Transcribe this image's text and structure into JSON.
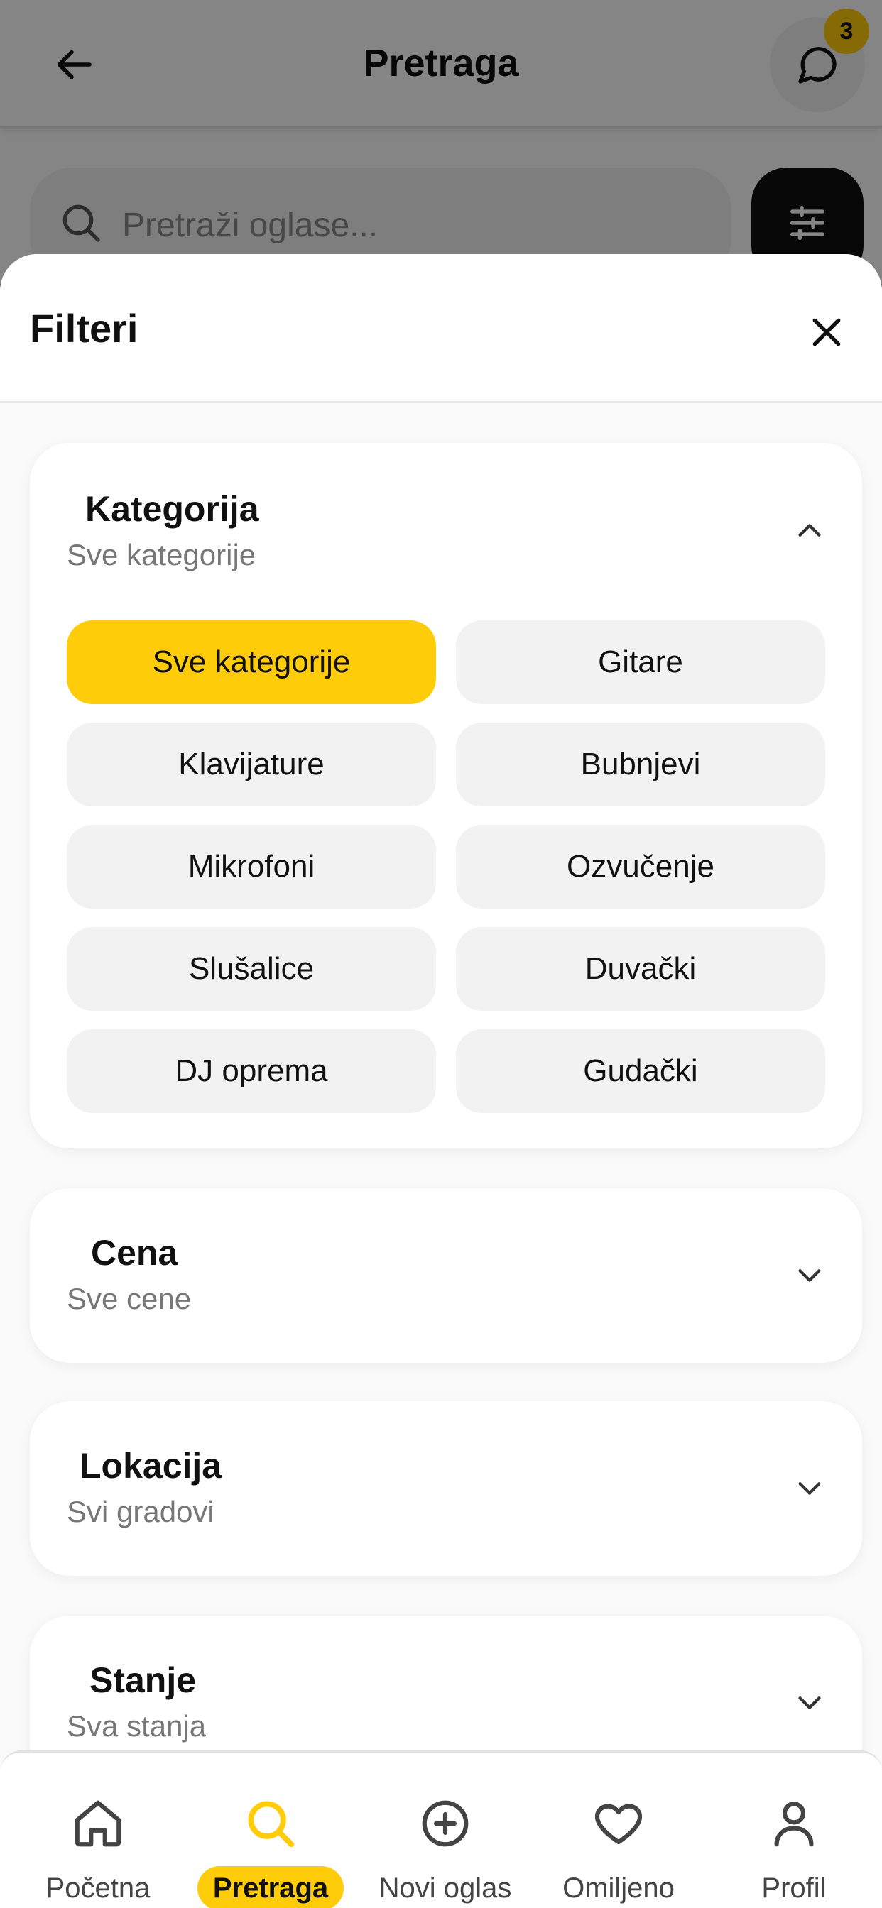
{
  "header": {
    "title": "Pretraga",
    "badge_count": "3"
  },
  "search": {
    "placeholder": "Pretraži oglase..."
  },
  "filters": {
    "title": "Filteri",
    "category": {
      "title": "Kategorija",
      "selected": "Sve kategorije",
      "options": [
        "Sve kategorije",
        "Gitare",
        "Klavijature",
        "Bubnjevi",
        "Mikrofoni",
        "Ozvučenje",
        "Slušalice",
        "Duvački",
        "DJ oprema",
        "Gudački"
      ]
    },
    "price": {
      "title": "Cena",
      "selected": "Sve cene"
    },
    "location": {
      "title": "Lokacija",
      "selected": "Svi gradovi"
    },
    "condition": {
      "title": "Stanje",
      "selected": "Sva stanja"
    }
  },
  "nav": {
    "items": [
      {
        "label": "Početna",
        "icon": "home-icon"
      },
      {
        "label": "Pretraga",
        "icon": "search-icon",
        "active": true
      },
      {
        "label": "Novi oglas",
        "icon": "plus-circle-icon"
      },
      {
        "label": "Omiljeno",
        "icon": "heart-icon"
      },
      {
        "label": "Profil",
        "icon": "user-icon"
      }
    ]
  },
  "colors": {
    "accent": "#ffcc0a",
    "chip_bg": "#f2f2f2",
    "text": "#111111",
    "muted": "#777777"
  }
}
